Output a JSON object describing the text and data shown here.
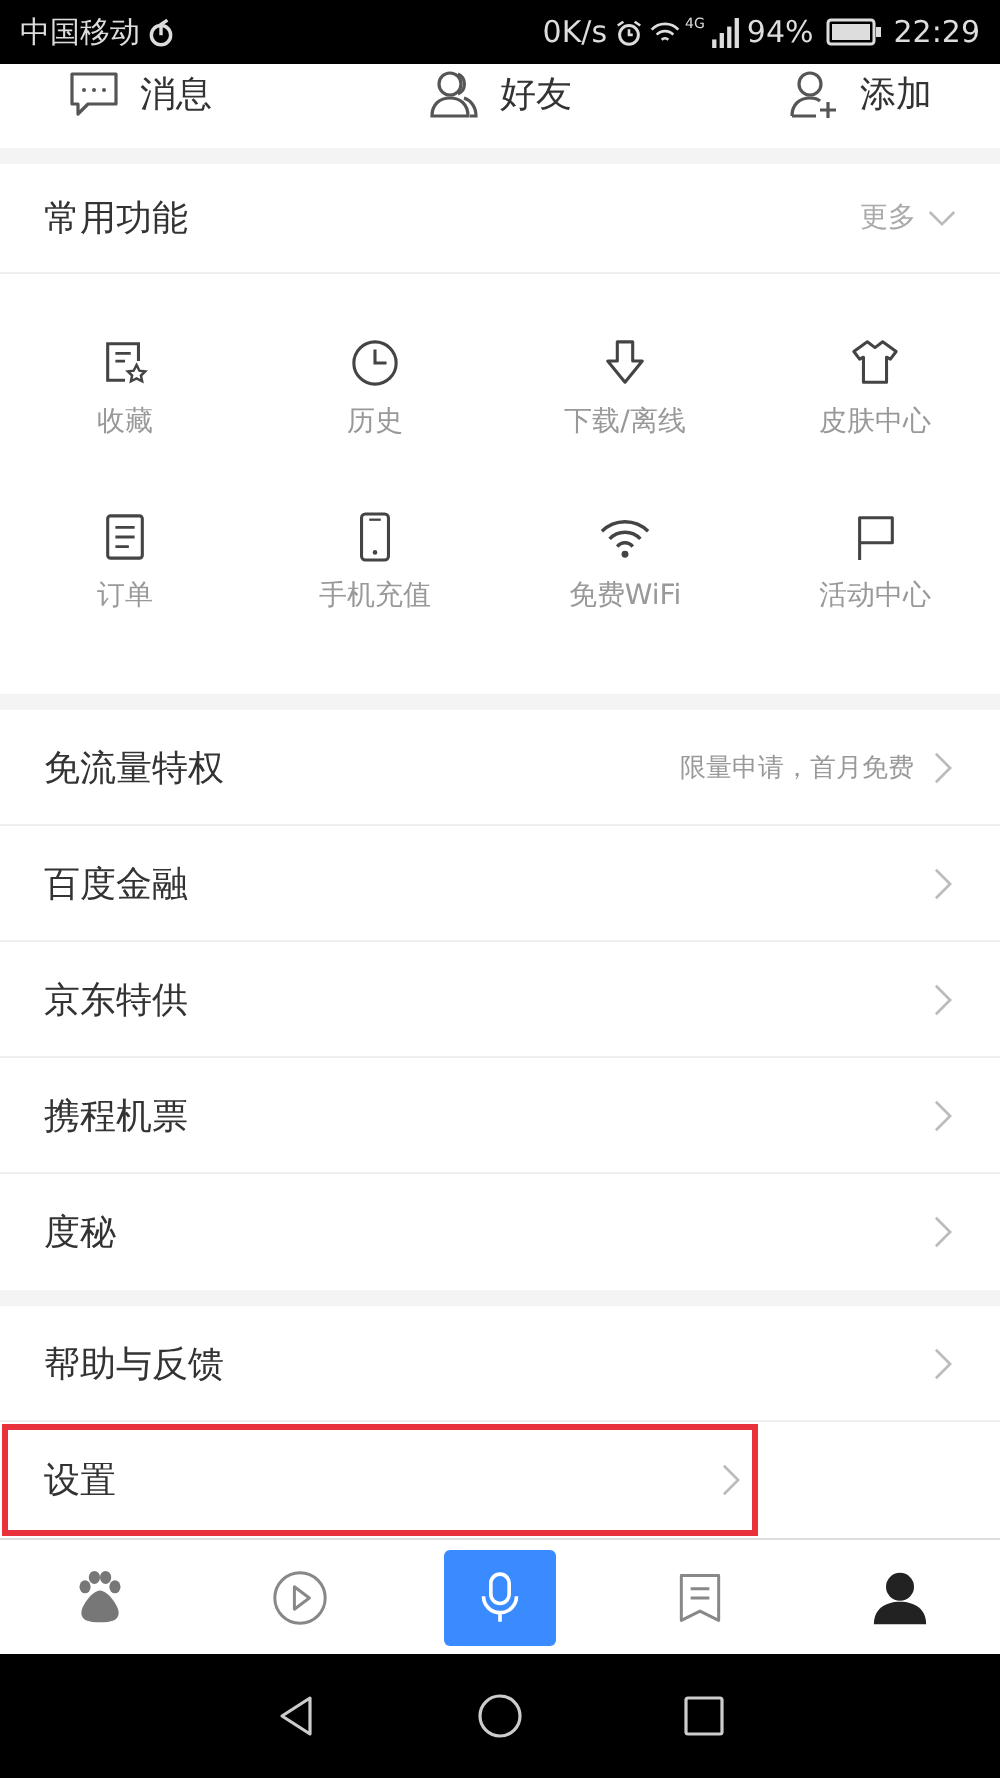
{
  "status_bar": {
    "carrier": "中国移动",
    "speed": "0K/s",
    "network": "4G",
    "battery": "94%",
    "time": "22:29"
  },
  "top_actions": [
    {
      "kind": "message",
      "label": "消息"
    },
    {
      "kind": "friends",
      "label": "好友"
    },
    {
      "kind": "add-user",
      "label": "添加"
    }
  ],
  "common_functions": {
    "title": "常用功能",
    "more": "更多",
    "items": [
      {
        "kind": "favorite",
        "label": "收藏"
      },
      {
        "kind": "clock",
        "label": "历史"
      },
      {
        "kind": "download",
        "label": "下载/离线"
      },
      {
        "kind": "shirt",
        "label": "皮肤中心"
      },
      {
        "kind": "order",
        "label": "订单"
      },
      {
        "kind": "phone",
        "label": "手机充值"
      },
      {
        "kind": "wifi",
        "label": "免费WiFi"
      },
      {
        "kind": "flag",
        "label": "活动中心"
      }
    ]
  },
  "menu_groups": [
    [
      {
        "label": "免流量特权",
        "note": "限量申请，首月免费",
        "highlighted": false
      },
      {
        "label": "百度金融",
        "highlighted": false
      },
      {
        "label": "京东特供",
        "highlighted": false
      },
      {
        "label": "携程机票",
        "highlighted": false
      },
      {
        "label": "度秘",
        "highlighted": false
      }
    ],
    [
      {
        "label": "帮助与反馈",
        "highlighted": false
      },
      {
        "label": "设置",
        "highlighted": true
      }
    ]
  ],
  "bottom_nav": [
    {
      "kind": "home",
      "selected": false
    },
    {
      "kind": "video",
      "selected": false
    },
    {
      "kind": "voice"
    },
    {
      "kind": "feed",
      "selected": false
    },
    {
      "kind": "profile",
      "selected": true
    }
  ]
}
